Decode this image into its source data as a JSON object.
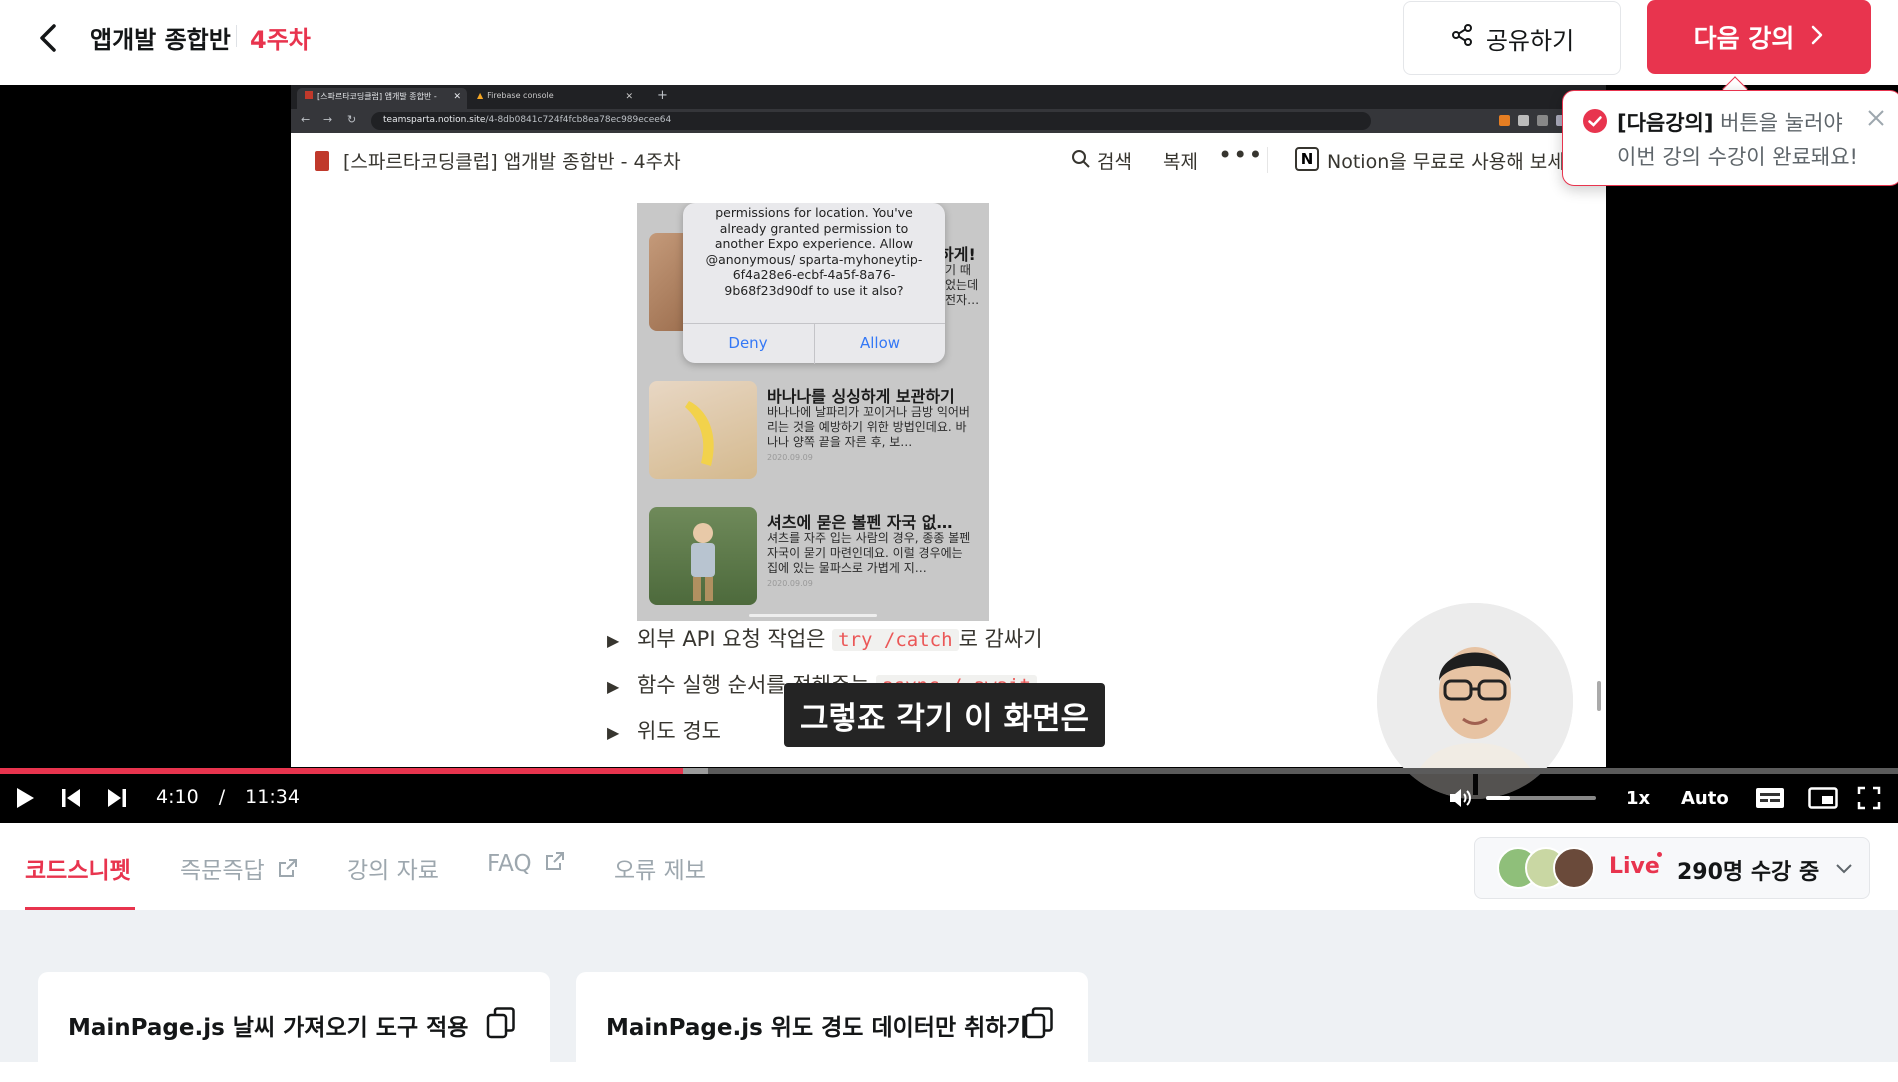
{
  "header": {
    "course_title": "앱개발 종합반",
    "week": "4주차",
    "share_label": "공유하기",
    "next_label": "다음 강의"
  },
  "tooltip": {
    "line1_bold": "[다음강의]",
    "line1_rest": " 버튼을 눌러야",
    "line2": "이번 강의 수강이 완료돼요!"
  },
  "browser": {
    "tab1": "[스파르타코딩클럽] 앱개발 종합반 -",
    "tab2": "Firebase console",
    "url_host": "teamsparta.notion.site",
    "url_path": "/4-8db0841c724f4fcb8ea78ec989ecee64"
  },
  "notion": {
    "page_title": "[스파르타코딩클럽] 앱개발 종합반 - 4주차",
    "search": "검색",
    "duplicate": "복제",
    "more": "•••",
    "free": "Notion을 무료로 사용해 보세"
  },
  "phone": {
    "dialog_text": "permissions for location. You've already granted permission to another Expo experience. Allow @anonymous/ sparta-myhoneytip-6f4a28e6-ecbf-4a5f-8a76-9b68f23d90df to use it also?",
    "deny": "Deny",
    "allow": "Allow",
    "partial_title": "하게!",
    "partial_body": "기 때\n었는데\n전자…",
    "cards": [
      {
        "title": "바나나를 싱싱하게 보관하기",
        "body": "바나나에 날파리가 꼬이거나 금방 익어버리는 것을 예방하기 위한 방법인데요. 바나나 양쪽 끝을 자른 후, 보…",
        "date": "2020.09.09"
      },
      {
        "title": "셔츠에 묻은 볼펜 자국 없…",
        "body": "셔츠를 자주 입는 사람의 경우, 종종 볼펜 자국이 묻기 마련인데요. 이럴 경우에는 집에 있는 물파스로 가볍게 지…",
        "date": "2020.09.09"
      }
    ]
  },
  "toggles": [
    {
      "before": "외부 API 요청 작업은 ",
      "code": "try /catch",
      "after": "로 감싸기"
    },
    {
      "before": "함수 실행 순서를 정해주는 ",
      "code": "async / await",
      "after": ""
    },
    {
      "before": "위도 경도",
      "code": "",
      "after": ""
    }
  ],
  "caption": "그렇죠 각기 이 화면은",
  "player": {
    "current_time": "4:10",
    "separator": "/",
    "duration": "11:34",
    "played_fraction": 0.36,
    "buffered_fraction": 0.373,
    "volume_fraction": 0.22,
    "speed": "1x",
    "quality": "Auto"
  },
  "tabs": [
    {
      "label": "코드스니펫",
      "active": true,
      "external": false
    },
    {
      "label": "즉문즉답",
      "active": false,
      "external": true
    },
    {
      "label": "강의 자료",
      "active": false,
      "external": false
    },
    {
      "label": "FAQ",
      "active": false,
      "external": true
    },
    {
      "label": "오류 제보",
      "active": false,
      "external": false
    }
  ],
  "live": {
    "label": "Live",
    "count_text": "290명 수강 중"
  },
  "snippets": [
    {
      "title": "MainPage.js 날씨 가져오기 도구 적용"
    },
    {
      "title": "MainPage.js 위도 경도 데이터만 취하기"
    }
  ],
  "colors": {
    "brand": "#e8344e",
    "text": "#141617",
    "muted_tab": "#9da7ae"
  }
}
